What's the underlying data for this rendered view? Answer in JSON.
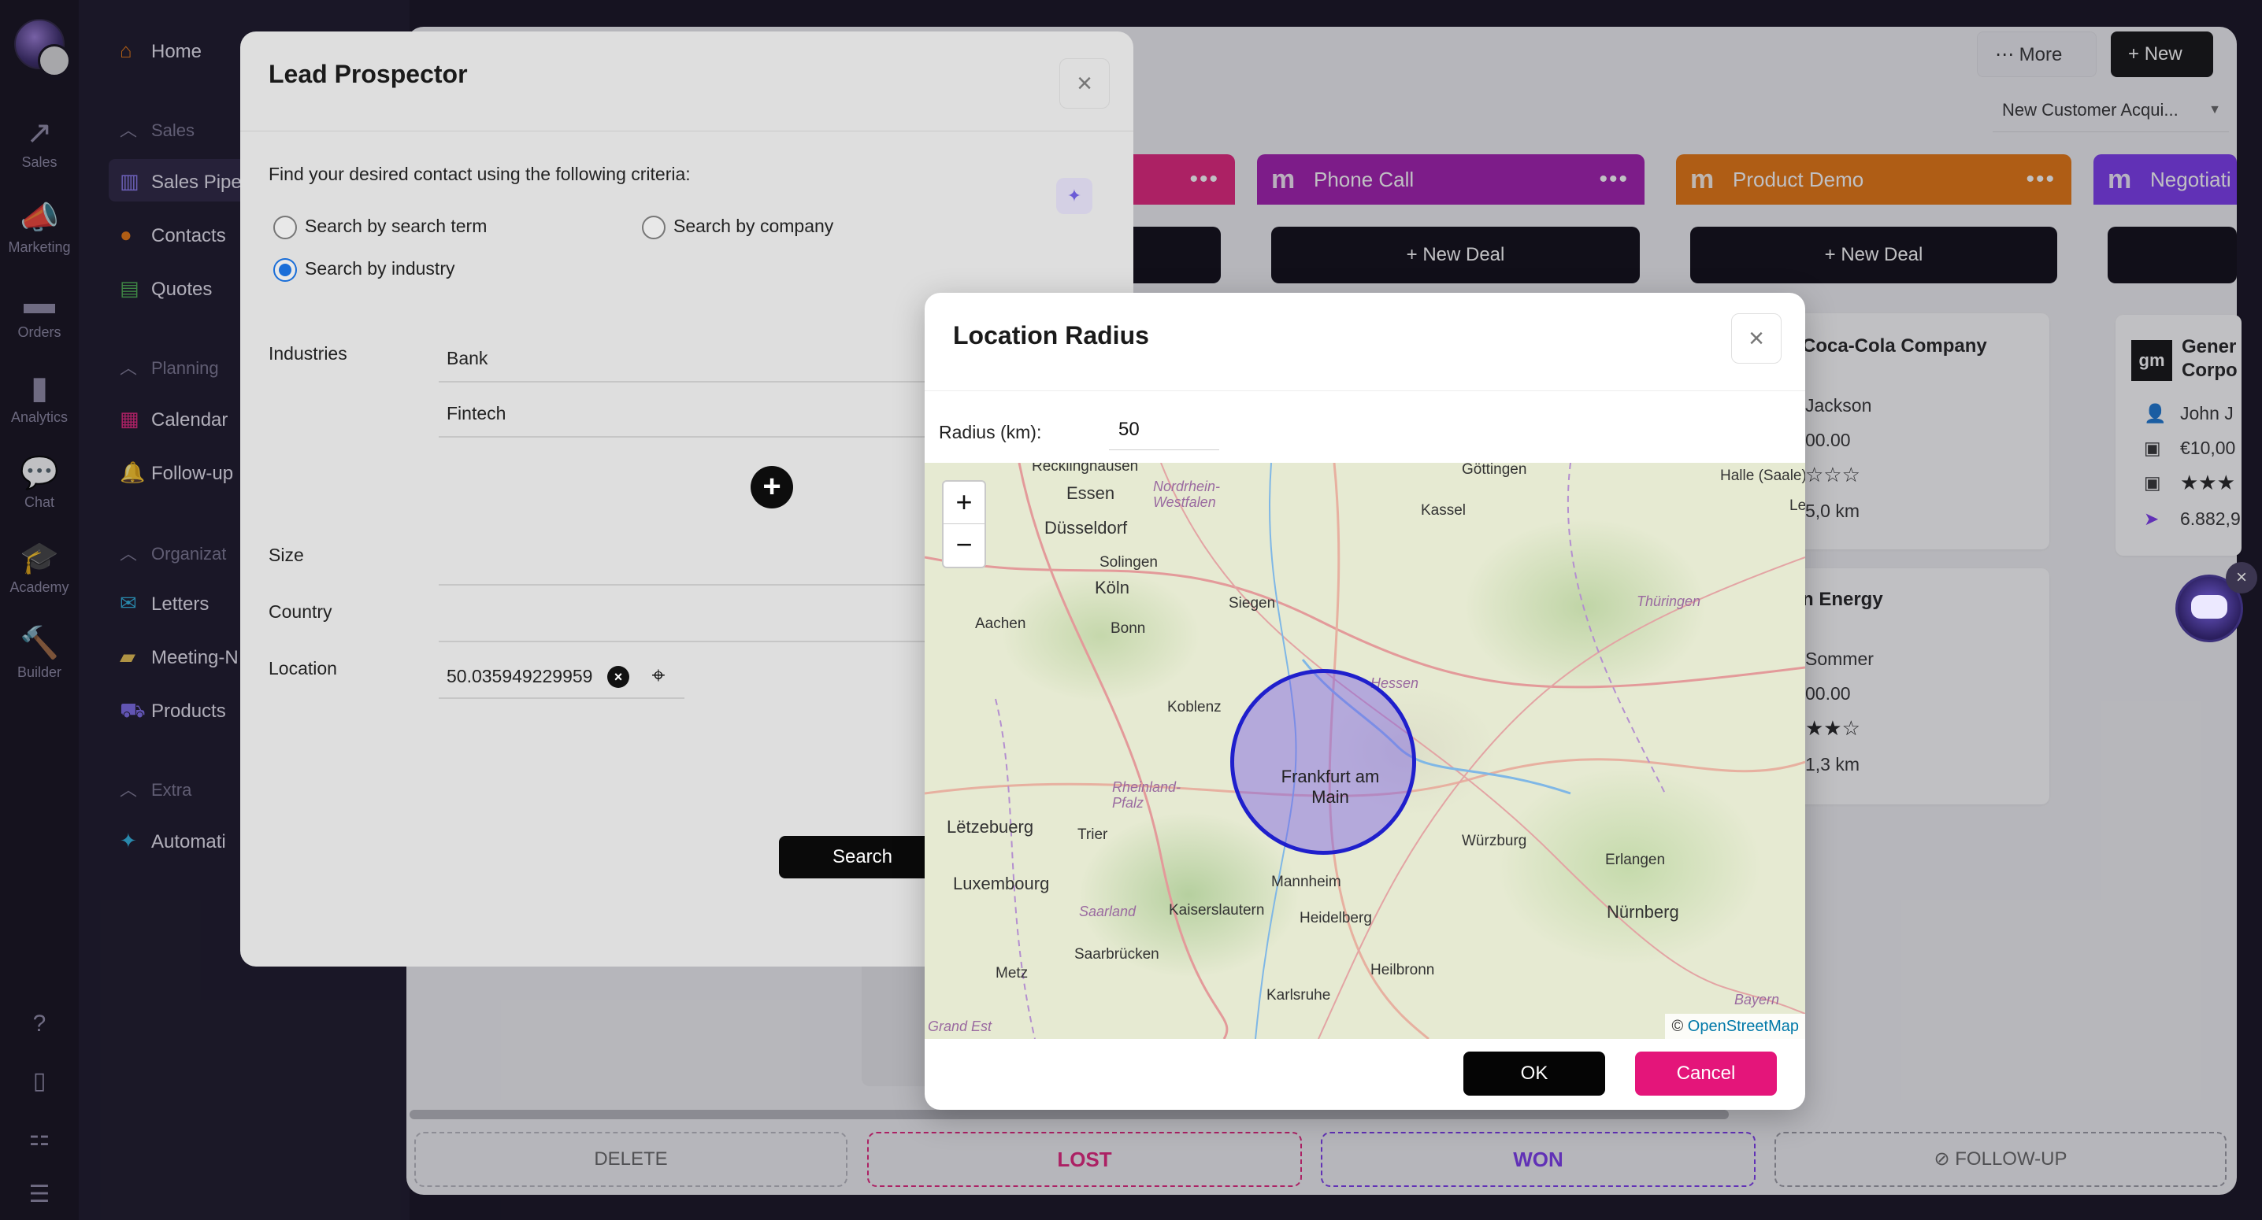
{
  "rail": {
    "items": [
      {
        "icon": "sales-icon",
        "glyph": "↗",
        "label": "Sales"
      },
      {
        "icon": "marketing-icon",
        "glyph": "📣",
        "label": "Marketing"
      },
      {
        "icon": "orders-icon",
        "glyph": "▬",
        "label": "Orders"
      },
      {
        "icon": "analytics-icon",
        "glyph": "▮",
        "label": "Analytics"
      },
      {
        "icon": "chat-icon",
        "glyph": "💬",
        "label": "Chat"
      },
      {
        "icon": "academy-icon",
        "glyph": "🎓",
        "label": "Academy"
      },
      {
        "icon": "builder-icon",
        "glyph": "🔨",
        "label": "Builder"
      }
    ],
    "bottom": [
      {
        "icon": "help-icon",
        "glyph": "?"
      },
      {
        "icon": "mobile-icon",
        "glyph": "▯"
      },
      {
        "icon": "apps-icon",
        "glyph": "⚏"
      },
      {
        "icon": "settings-sliders-icon",
        "glyph": "☰"
      }
    ]
  },
  "nav": {
    "home": "Home",
    "sales_head": "Sales",
    "sales_pipeline": "Sales Pipe",
    "contacts": "Contacts",
    "quotes": "Quotes",
    "planning_head": "Planning",
    "calendar": "Calendar",
    "followup": "Follow-up",
    "organization_head": "Organizat",
    "letters": "Letters",
    "meeting": "Meeting-N",
    "products": "Products",
    "extra_head": "Extra",
    "automation": "Automati"
  },
  "board": {
    "more_label": "More",
    "new_label": "New",
    "view_select": "New Customer Acqui...",
    "columns": [
      {
        "name": "Phone Call",
        "color": "#a21caf",
        "new_deal": "New Deal"
      },
      {
        "name": "Product Demo",
        "color": "#e8770f",
        "new_deal": "New Deal"
      },
      {
        "name": "Negotiati",
        "color": "#7c3aed",
        "new_deal": ""
      }
    ],
    "cards": [
      {
        "title": "Coca-Cola Company",
        "person": "Jackson",
        "amount": "00.00",
        "distance": "5,0 km"
      },
      {
        "title": "n Energy",
        "person": "Sommer",
        "amount": "00.00",
        "distance": "1,3 km"
      },
      {
        "title": "Genera Corpo",
        "person": "John J",
        "amount": "€10,00",
        "distance": "6.882,9",
        "logo": "gm"
      }
    ],
    "drop_zones": {
      "delete": "DELETE",
      "lost": "LOST",
      "won": "WON",
      "followup": "FOLLOW-UP"
    }
  },
  "lead": {
    "title": "Lead Prospector",
    "intro": "Find your desired contact using the following criteria:",
    "radio_search_term": "Search by search term",
    "radio_company": "Search by company",
    "radio_industry": "Search by industry",
    "selected": "Search by industry",
    "industries_label": "Industries",
    "industry_1": "Bank",
    "industry_2": "Fintech",
    "size_label": "Size",
    "country_label": "Country",
    "location_label": "Location",
    "location_value": "50.035949229959",
    "search_label": "Search"
  },
  "location_modal": {
    "title": "Location Radius",
    "radius_label": "Radius (km):",
    "radius_value": "50",
    "attribution_prefix": "©",
    "attribution_link": "OpenStreetMap",
    "ok_label": "OK",
    "cancel_label": "Cancel",
    "zoom_in": "+",
    "zoom_out": "−",
    "center_city": "Frankfurt am Main",
    "map_labels": [
      "Recklinghausen",
      "Essen",
      "Düsseldorf",
      "Solingen",
      "Köln",
      "Bonn",
      "Aachen",
      "Siegen",
      "Koblenz",
      "Kassel",
      "Göttingen",
      "Halle (Saale)",
      "Thüringen",
      "Nordrhein-Westfalen",
      "Hessen",
      "Rheinland-Pfalz",
      "Lëtzebuerg",
      "Trier",
      "Luxembourg",
      "Saarland",
      "Saarbrücken",
      "Kaiserslautern",
      "Mannheim",
      "Heidelberg",
      "Heilbronn",
      "Karlsruhe",
      "Metz",
      "Grand Est",
      "Würzburg",
      "Erlangen",
      "Nürnberg",
      "Bayern",
      "Le"
    ]
  }
}
